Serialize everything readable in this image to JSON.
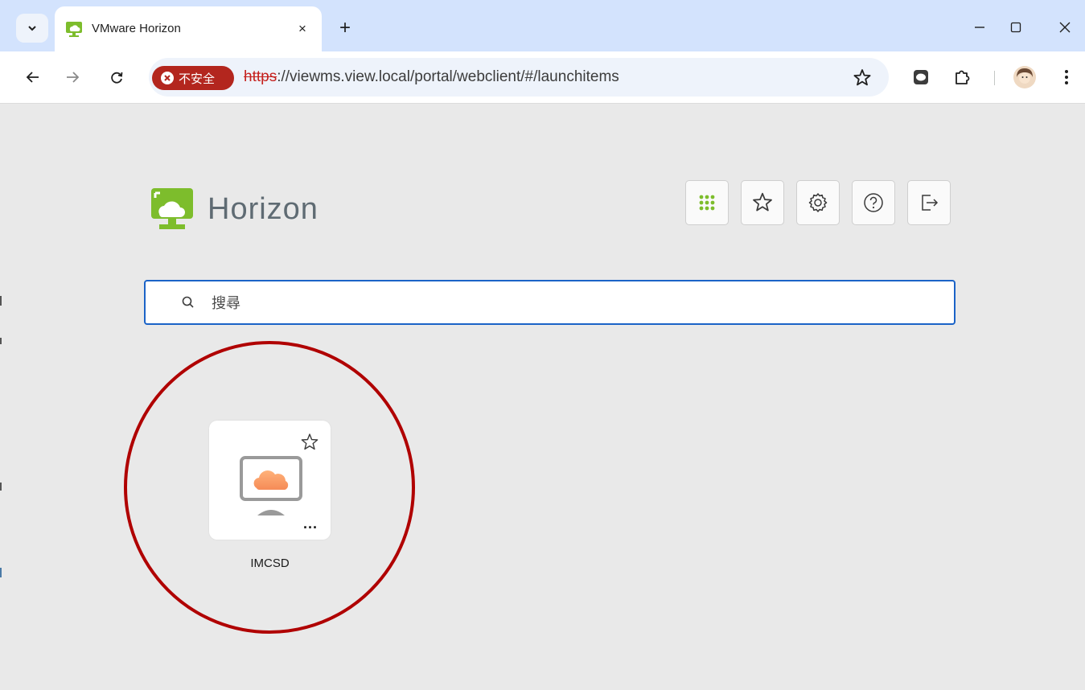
{
  "browser": {
    "tab": {
      "title": "VMware Horizon",
      "close_glyph": "×"
    },
    "new_tab_glyph": "+",
    "window_controls": {
      "minimize": "—",
      "maximize": "☐",
      "close": "✕"
    },
    "omnibox": {
      "security_label": "不安全",
      "url_protocol": "https",
      "url_rest": "://viewms.view.local/portal/webclient/#/launchitems"
    }
  },
  "header": {
    "brand_name": "Horizon",
    "actions": [
      {
        "name": "apps-grid-icon",
        "accent": "#7dbd2c"
      },
      {
        "name": "favorites-icon"
      },
      {
        "name": "settings-icon"
      },
      {
        "name": "help-icon"
      },
      {
        "name": "logout-icon"
      }
    ]
  },
  "search": {
    "placeholder": "搜尋"
  },
  "launch_items": [
    {
      "label": "IMCSD",
      "more_label": "...",
      "icon": "cloud-desktop-icon"
    }
  ],
  "colors": {
    "brand_green": "#7dbd2c",
    "focus_blue": "#1b63c7",
    "annotation_red": "#b00000",
    "insecure_red": "#b3261e",
    "cloud_orange": "#f6a06a"
  }
}
